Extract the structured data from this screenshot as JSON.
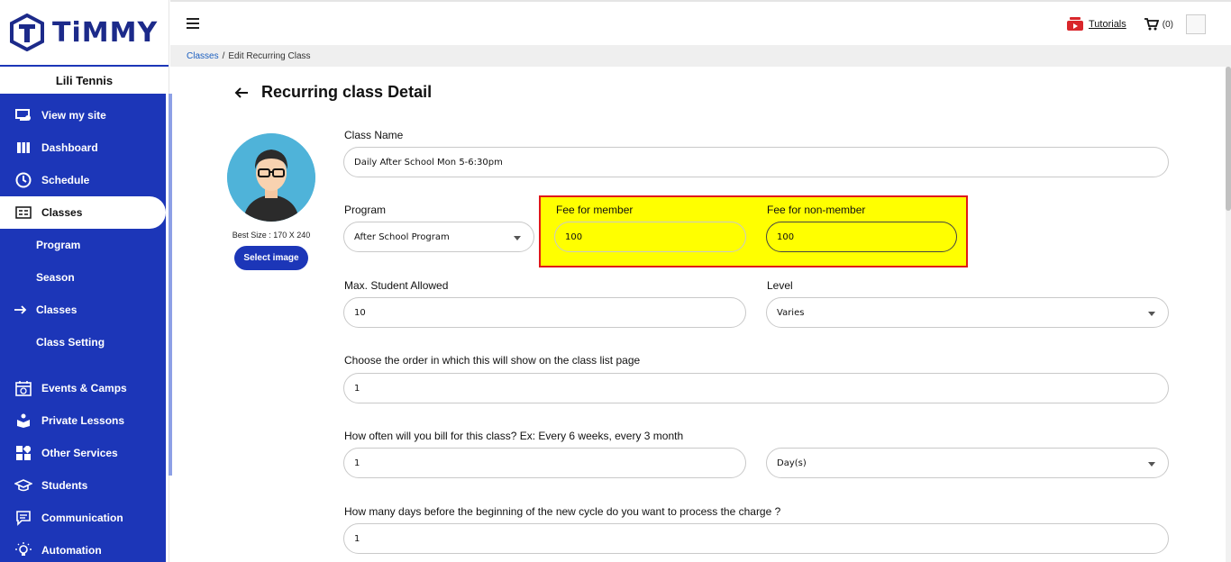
{
  "brand": {
    "name": "TiMMY"
  },
  "org": {
    "name": "Lili Tennis"
  },
  "sidebar": {
    "items": [
      {
        "label": "View my site",
        "icon": "monitor-icon"
      },
      {
        "label": "Dashboard",
        "icon": "dashboard-icon"
      },
      {
        "label": "Schedule",
        "icon": "clock-icon"
      },
      {
        "label": "Classes",
        "icon": "classes-icon",
        "active": true
      },
      {
        "label": "Program"
      },
      {
        "label": "Season"
      },
      {
        "label": "Classes",
        "icon": "arrow-right-icon"
      },
      {
        "label": "Class Setting"
      },
      {
        "label": "Events & Camps",
        "icon": "calendar-icon"
      },
      {
        "label": "Private Lessons",
        "icon": "lesson-icon"
      },
      {
        "label": "Other Services",
        "icon": "services-icon"
      },
      {
        "label": "Students",
        "icon": "graduation-cap-icon"
      },
      {
        "label": "Communication",
        "icon": "chat-icon"
      },
      {
        "label": "Automation",
        "icon": "lightbulb-icon"
      }
    ]
  },
  "topbar": {
    "tutorials": "Tutorials",
    "cart_count": "(0)"
  },
  "breadcrumb": {
    "parent": "Classes",
    "separator": "/",
    "current": "Edit Recurring Class"
  },
  "page": {
    "title": "Recurring class Detail"
  },
  "image": {
    "best_size": "Best Size : 170 X 240",
    "select_label": "Select image"
  },
  "form": {
    "class_name": {
      "label": "Class Name",
      "value": "Daily After School Mon 5-6:30pm"
    },
    "program": {
      "label": "Program",
      "value": "After School Program"
    },
    "fee_member": {
      "label": "Fee for member",
      "value": "100"
    },
    "fee_nonmember": {
      "label": "Fee for non-member",
      "value": "100"
    },
    "max_students": {
      "label": "Max. Student Allowed",
      "value": "10"
    },
    "level": {
      "label": "Level",
      "value": "Varies"
    },
    "order": {
      "label": "Choose the order in which this will show on the class list page",
      "value": "1"
    },
    "billing": {
      "label": "How often will you bill for this class? Ex: Every 6 weeks, every 3 month",
      "value": "1",
      "unit": "Day(s)"
    },
    "charge_days": {
      "label": "How many days before the beginning of the new cycle do you want to process the charge ?",
      "value": "1"
    }
  },
  "colors": {
    "primary": "#1c36b8",
    "highlight": "#ffff00",
    "highlight_border": "#e01818"
  }
}
